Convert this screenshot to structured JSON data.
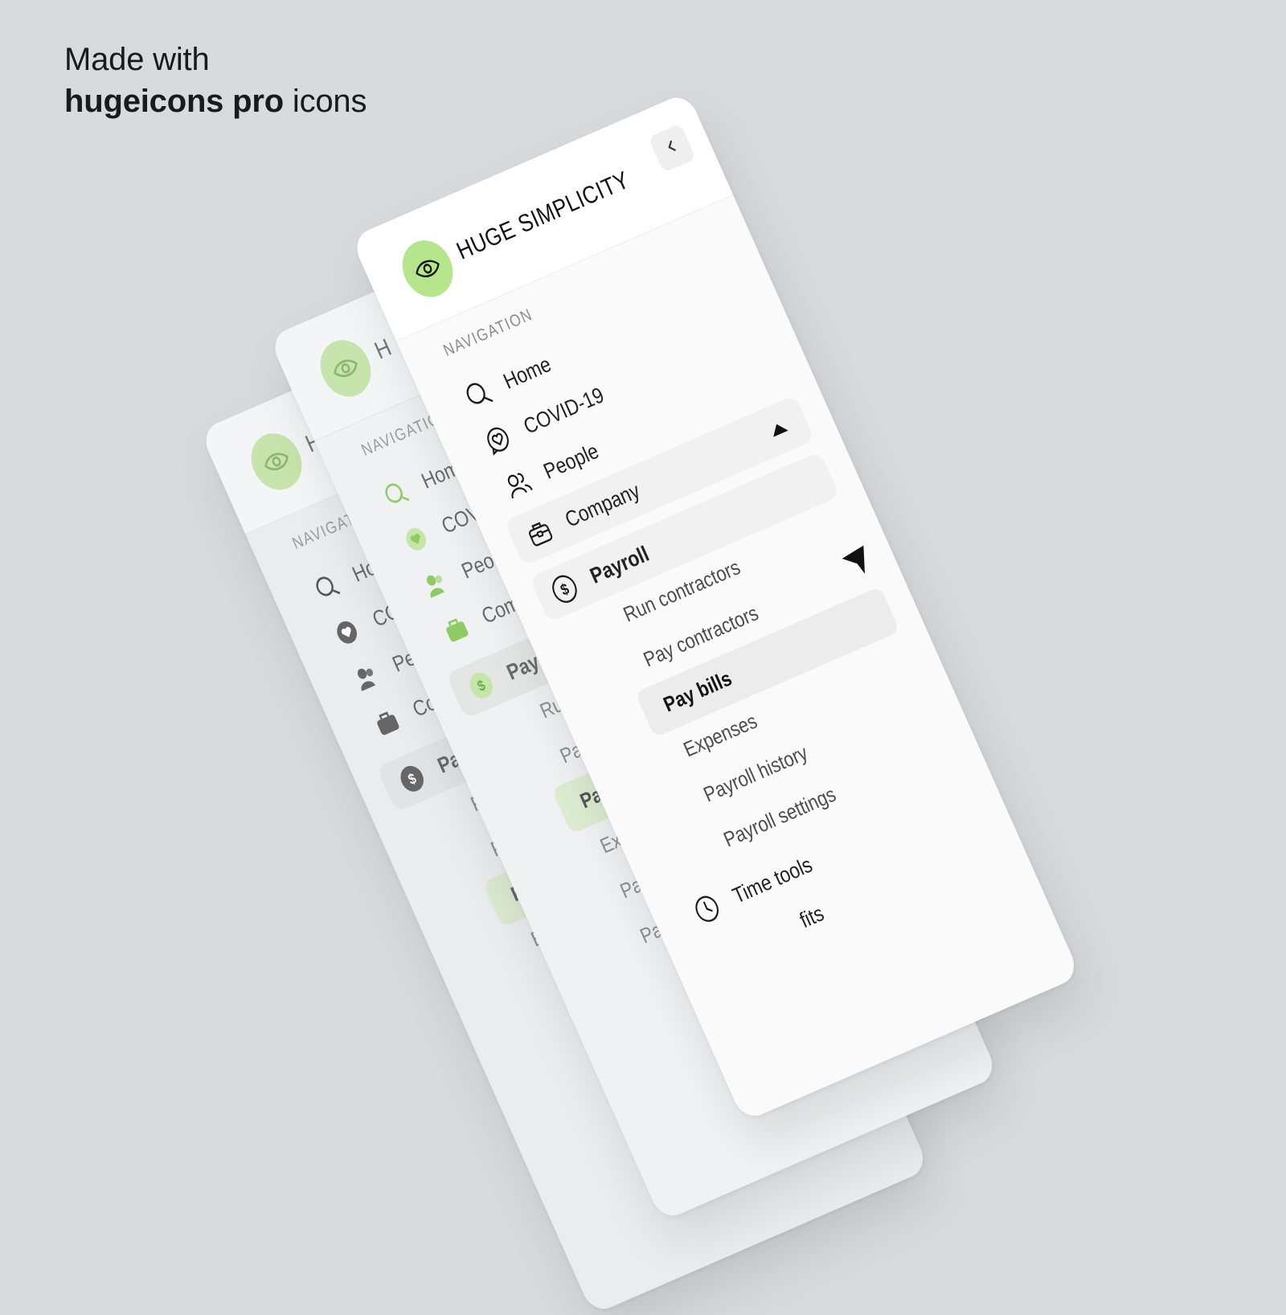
{
  "headline": {
    "line1": "Made with",
    "bold": "hugeicons pro",
    "rest": "icons"
  },
  "brand": {
    "name": "HUGE SIMPLICITY",
    "logo_icon": "eye-icon",
    "collapse_icon": "chevron-left-icon"
  },
  "nav": {
    "section_label": "NAVIGATION",
    "items": [
      {
        "label": "Home",
        "icon": "search-icon"
      },
      {
        "label": "COVID-19",
        "icon": "heart-chat-icon"
      },
      {
        "label": "People",
        "icon": "users-icon"
      },
      {
        "label": "Company",
        "icon": "briefcase-icon",
        "expanded": true
      }
    ],
    "payroll": {
      "label": "Payroll",
      "icon": "dollar-circle-icon",
      "sub_items": [
        "Run contractors",
        "Pay contractors",
        "Pay bills",
        "Expenses",
        "Payroll history",
        "Payroll settings"
      ],
      "active": "Pay bills"
    },
    "time_tools": {
      "label": "Time tools",
      "icon": "clock-icon"
    },
    "partial_item": "fits"
  },
  "back_panels": {
    "mid": {
      "brand_partial": "H",
      "label_partial": "NAVIGATIO",
      "items": [
        "Hom",
        "COV",
        "Peop",
        "Com"
      ],
      "payroll_partial": "Payr",
      "subs": [
        "Run",
        "Pay",
        "Pay",
        "Exp",
        "Pay",
        "Pay"
      ]
    },
    "back": {
      "brand_partial": "H",
      "label_partial": "NAVIGAT",
      "items": [
        "Hor",
        "CO",
        "Pec",
        "Coi"
      ],
      "payroll_partial": "Pay",
      "subs": [
        "Ru",
        "Pa",
        "Pa",
        "Ex"
      ]
    }
  },
  "colors": {
    "accent": "#b5e68c",
    "background": "#d9dadd",
    "panel": "#fafafa"
  }
}
